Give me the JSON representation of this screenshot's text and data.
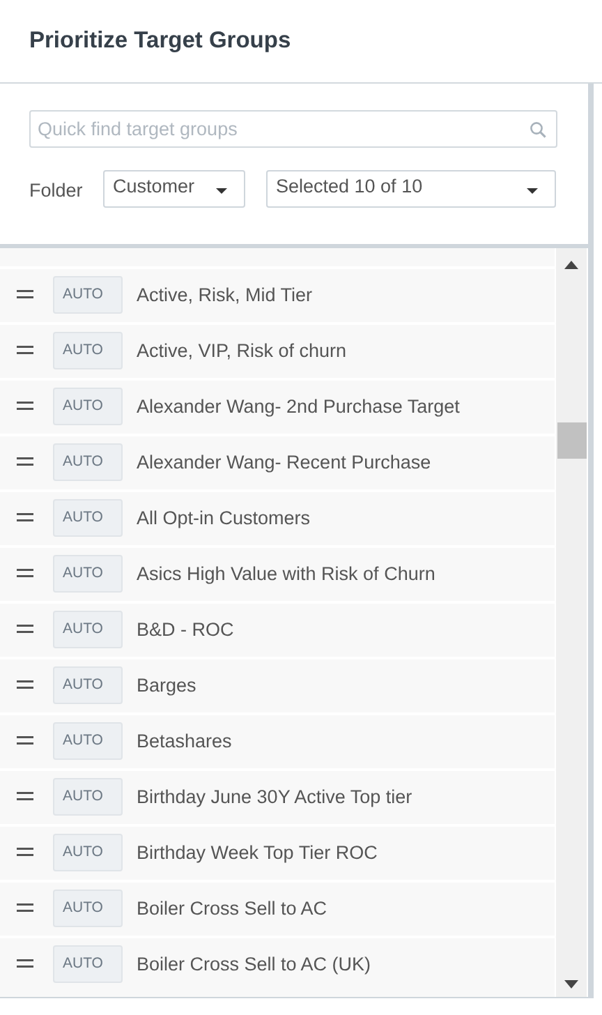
{
  "title": "Prioritize Target Groups",
  "search": {
    "placeholder": "Quick find target groups"
  },
  "folder": {
    "label": "Folder",
    "value": "Customer"
  },
  "selection": {
    "value": "Selected 10 of 10"
  },
  "groups": [
    {
      "mode": "AUTO",
      "name": "Active, Risk, Mid Tier"
    },
    {
      "mode": "AUTO",
      "name": "Active, VIP, Risk of churn"
    },
    {
      "mode": "AUTO",
      "name": "Alexander Wang- 2nd Purchase Target"
    },
    {
      "mode": "AUTO",
      "name": "Alexander Wang- Recent Purchase"
    },
    {
      "mode": "AUTO",
      "name": "All Opt-in Customers"
    },
    {
      "mode": "AUTO",
      "name": "Asics High Value with Risk of Churn"
    },
    {
      "mode": "AUTO",
      "name": "B&D - ROC"
    },
    {
      "mode": "AUTO",
      "name": "Barges"
    },
    {
      "mode": "AUTO",
      "name": "Betashares"
    },
    {
      "mode": "AUTO",
      "name": "Birthday June 30Y Active Top tier"
    },
    {
      "mode": "AUTO",
      "name": "Birthday Week Top Tier ROC"
    },
    {
      "mode": "AUTO",
      "name": "Boiler Cross Sell to AC"
    },
    {
      "mode": "AUTO",
      "name": "Boiler Cross Sell to AC (UK)"
    }
  ]
}
